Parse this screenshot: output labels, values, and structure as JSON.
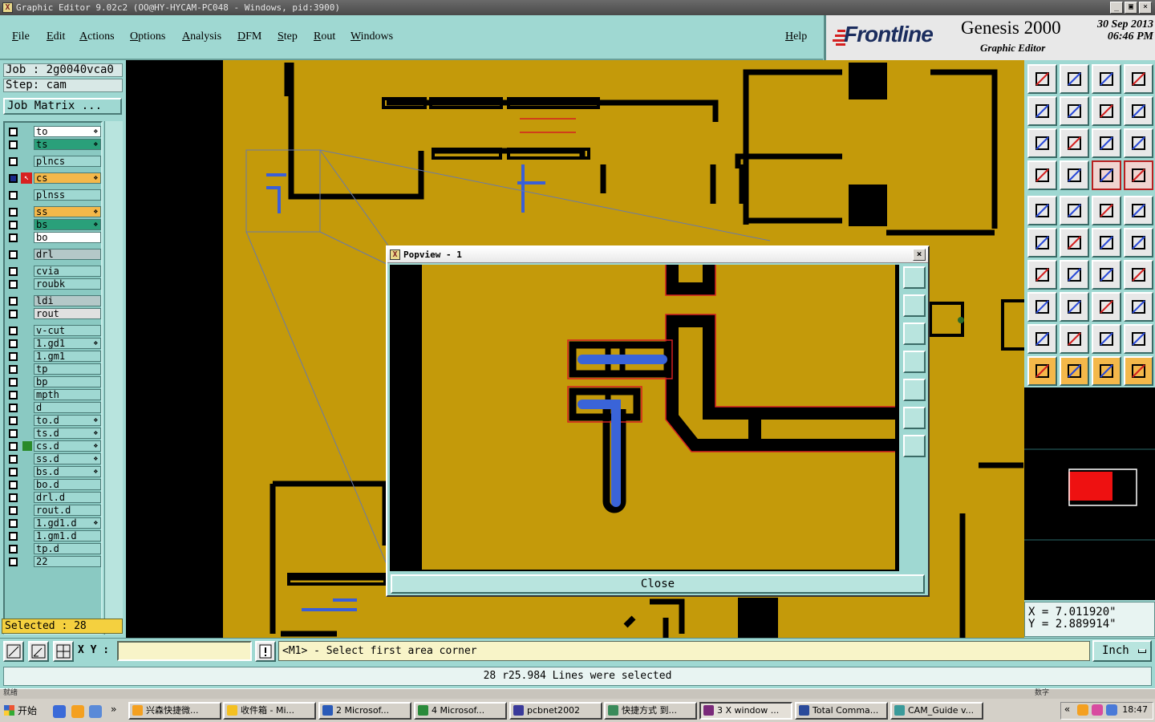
{
  "window": {
    "title": "Graphic Editor 9.02c2 (OO@HY-HYCAM-PC048 - Windows, pid:3900)",
    "minimize": "_",
    "restore": "▣",
    "close": "×"
  },
  "menu": [
    "File",
    "Edit",
    "Actions",
    "Options",
    "Analysis",
    "DFM",
    "Step",
    "Rout",
    "Windows"
  ],
  "help_label": "Help",
  "brand": {
    "logo": "Frontline",
    "product": "Genesis 2000",
    "subtitle": "Graphic Editor",
    "date": "30  Sep  2013",
    "time": "06:46  PM"
  },
  "job": {
    "job_line": "Job  :  2g0040vca0",
    "step_line": "Step:  cam",
    "matrix_button": "Job Matrix ..."
  },
  "layers": [
    {
      "name": "to",
      "color": "#ffffff",
      "mark": "❖"
    },
    {
      "name": "ts",
      "color": "#2aa07a",
      "mark": "❖"
    },
    {
      "name": "plncs",
      "color": "#9fd8d2",
      "mark": ""
    },
    {
      "name": "cs",
      "color": "#f4b84a",
      "mark": "❖",
      "active": true
    },
    {
      "name": "plnss",
      "color": "#9fd8d2",
      "mark": ""
    },
    {
      "name": "ss",
      "color": "#f4b84a",
      "mark": "❖"
    },
    {
      "name": "bs",
      "color": "#2aa07a",
      "mark": "❖"
    },
    {
      "name": "bo",
      "color": "#ffffff",
      "mark": ""
    },
    {
      "name": "drl",
      "color": "#b4c8c8",
      "mark": ""
    },
    {
      "name": "cvia",
      "color": "#9fd8d2",
      "mark": ""
    },
    {
      "name": "roubk",
      "color": "#9fd8d2",
      "mark": ""
    },
    {
      "name": "ldi",
      "color": "#b4c8c8",
      "mark": ""
    },
    {
      "name": "rout",
      "color": "#e0e0e0",
      "mark": ""
    },
    {
      "name": "v-cut",
      "color": "#9fd8d2",
      "mark": ""
    },
    {
      "name": "1.gd1",
      "color": "#9fd8d2",
      "mark": "❖"
    },
    {
      "name": "1.gm1",
      "color": "#9fd8d2",
      "mark": ""
    },
    {
      "name": "tp",
      "color": "#9fd8d2",
      "mark": ""
    },
    {
      "name": "bp",
      "color": "#9fd8d2",
      "mark": ""
    },
    {
      "name": "mpth",
      "color": "#9fd8d2",
      "mark": ""
    },
    {
      "name": "d",
      "color": "#9fd8d2",
      "mark": ""
    },
    {
      "name": "to.d",
      "color": "#9fd8d2",
      "mark": "❖"
    },
    {
      "name": "ts.d",
      "color": "#9fd8d2",
      "mark": "❖"
    },
    {
      "name": "cs.d",
      "color": "#9fd8d2",
      "mark": "❖"
    },
    {
      "name": "ss.d",
      "color": "#9fd8d2",
      "mark": "❖"
    },
    {
      "name": "bs.d",
      "color": "#9fd8d2",
      "mark": "❖"
    },
    {
      "name": "bo.d",
      "color": "#9fd8d2",
      "mark": ""
    },
    {
      "name": "drl.d",
      "color": "#9fd8d2",
      "mark": ""
    },
    {
      "name": "rout.d",
      "color": "#9fd8d2",
      "mark": ""
    },
    {
      "name": "1.gd1.d",
      "color": "#9fd8d2",
      "mark": "❖"
    },
    {
      "name": "1.gm1.d",
      "color": "#9fd8d2",
      "mark": ""
    },
    {
      "name": "tp.d",
      "color": "#9fd8d2",
      "mark": ""
    },
    {
      "name": "22",
      "color": "#9fd8d2",
      "mark": ""
    }
  ],
  "selected_count": "Selected : 28",
  "popview": {
    "title": "Popview - 1",
    "close_button": "Close"
  },
  "coords": {
    "x": "X = 7.011920\"",
    "y": "Y = 2.889914\""
  },
  "command": {
    "xy_label": "X Y :",
    "xy_value": "",
    "prompt": "<M1> - Select first area corner",
    "units": "Inch",
    "status": "28 r25.984 Lines were selected"
  },
  "taskbar": {
    "strip_left": "就绪",
    "strip_right": "数字",
    "start": "开始",
    "items": [
      {
        "label": "兴森快捷微...",
        "color": "#f4a020"
      },
      {
        "label": "收件箱 - Mi...",
        "color": "#f4c020"
      },
      {
        "label": "2 Microsof...",
        "color": "#2a5ab8"
      },
      {
        "label": "4 Microsof...",
        "color": "#2a8a3a"
      },
      {
        "label": "pcbnet2002",
        "color": "#3a3a9a"
      },
      {
        "label": "快捷方式 到...",
        "color": "#3a8a5a"
      },
      {
        "label": "3 X window ...",
        "color": "#7a2a7a",
        "active": true
      },
      {
        "label": "Total Comma...",
        "color": "#2a4a9a"
      },
      {
        "label": "CAM_Guide v...",
        "color": "#3a9a9a"
      }
    ],
    "clock": "18:47"
  }
}
